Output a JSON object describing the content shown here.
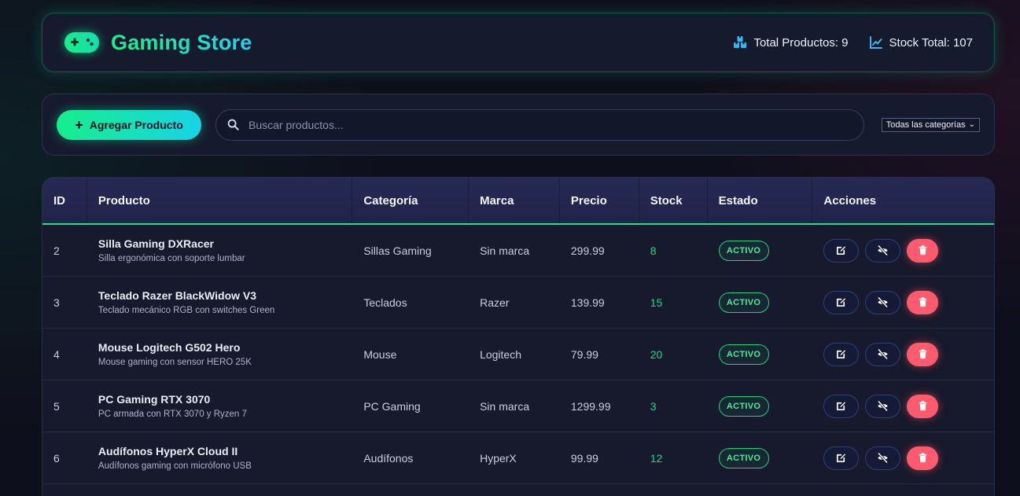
{
  "header": {
    "title": "Gaming Store",
    "icon": "gamepad-icon",
    "stats": {
      "total_products_label": "Total Productos: 9",
      "stock_total_label": "Stock Total: 107"
    }
  },
  "toolbar": {
    "add_label": "Agregar Producto",
    "search_placeholder": "Buscar productos...",
    "category_filter": "Todas las categorías"
  },
  "table": {
    "headers": {
      "id": "ID",
      "product": "Producto",
      "category": "Categoría",
      "brand": "Marca",
      "price": "Precio",
      "stock": "Stock",
      "state": "Estado",
      "actions": "Acciones"
    },
    "rows": [
      {
        "id": "2",
        "name": "Silla Gaming DXRacer",
        "desc": "Silla ergonómica con soporte lumbar",
        "category": "Sillas Gaming",
        "brand": "Sin marca",
        "price": "299.99",
        "stock": "8",
        "state": "ACTIVO"
      },
      {
        "id": "3",
        "name": "Teclado Razer BlackWidow V3",
        "desc": "Teclado mecánico RGB con switches Green",
        "category": "Teclados",
        "brand": "Razer",
        "price": "139.99",
        "stock": "15",
        "state": "ACTIVO"
      },
      {
        "id": "4",
        "name": "Mouse Logitech G502 Hero",
        "desc": "Mouse gaming con sensor HERO 25K",
        "category": "Mouse",
        "brand": "Logitech",
        "price": "79.99",
        "stock": "20",
        "state": "ACTIVO"
      },
      {
        "id": "5",
        "name": "PC Gaming RTX 3070",
        "desc": "PC armada con RTX 3070 y Ryzen 7",
        "category": "PC Gaming",
        "brand": "Sin marca",
        "price": "1299.99",
        "stock": "3",
        "state": "ACTIVO"
      },
      {
        "id": "6",
        "name": "Audífonos HyperX Cloud II",
        "desc": "Audífonos gaming con micrófono USB",
        "category": "Audífonos",
        "brand": "HyperX",
        "price": "99.99",
        "stock": "12",
        "state": "ACTIVO"
      }
    ]
  },
  "colors": {
    "accent_green": "#19f08a",
    "accent_cyan": "#1fd3f0",
    "danger": "#ff5b6f",
    "background": "#0e0f1c",
    "panel": "#161a2d"
  }
}
